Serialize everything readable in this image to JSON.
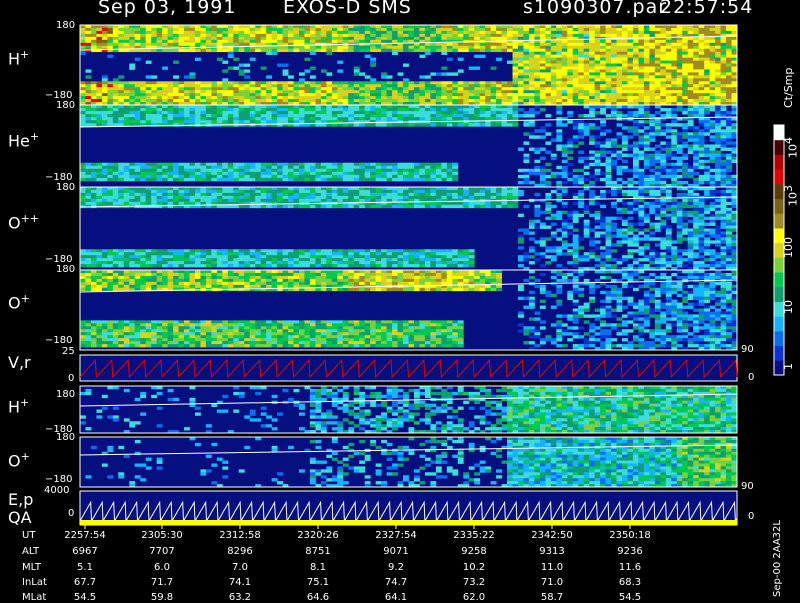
{
  "header": {
    "date": "Sep 03, 1991",
    "instrument": "EXOS-D SMS",
    "file": "s1090307.par",
    "time": "22:57:54"
  },
  "colorbar": {
    "unit": "Ct/Smp",
    "ticks": [
      "1",
      "10",
      "100",
      "10",
      "10"
    ],
    "tick_exps": [
      "",
      "",
      "",
      "3",
      "4"
    ],
    "colors": [
      "#050f80",
      "#0a32d2",
      "#0a6ef0",
      "#14b4ff",
      "#3cdcdc",
      "#0f9f6f",
      "#00c850",
      "#78d23c",
      "#d7d21e",
      "#ffff00",
      "#a08c1e",
      "#786414",
      "#5a3c0a",
      "#e60000",
      "#b40000",
      "#460000",
      "#ffffff"
    ]
  },
  "panels": [
    {
      "id": "h",
      "name": "H",
      "sup": "+",
      "top": "180",
      "bot": "−180"
    },
    {
      "id": "he",
      "name": "He",
      "sup": "+",
      "top": "180",
      "bot": "−180"
    },
    {
      "id": "o2",
      "name": "O",
      "sup": "++",
      "top": "180",
      "bot": "−180"
    },
    {
      "id": "o",
      "name": "O",
      "sup": "+",
      "top": "180",
      "bot": "−180"
    },
    {
      "id": "vr",
      "name": "V,r",
      "sup": "",
      "top": "25",
      "bot": "0",
      "right_top": "90",
      "right_bot": "0"
    },
    {
      "id": "h2",
      "name": "H",
      "sup": "+",
      "top": "180",
      "bot": "−180"
    },
    {
      "id": "o3",
      "name": "O",
      "sup": "+",
      "top": "180",
      "bot": "−180",
      "right_bot": "90"
    },
    {
      "id": "ep",
      "name": "E,p",
      "name2": "QA",
      "sup": "",
      "top": "4000",
      "bot": "0",
      "right_bot": "0"
    }
  ],
  "table": {
    "rows": [
      {
        "label": "UT",
        "values": [
          "2257:54",
          "2305:30",
          "2312:58",
          "2320:26",
          "2327:54",
          "2335:22",
          "2342:50",
          "2350:18"
        ]
      },
      {
        "label": "ALT",
        "values": [
          "6967",
          "7707",
          "8296",
          "8751",
          "9071",
          "9258",
          "9313",
          "9236"
        ]
      },
      {
        "label": "MLT",
        "values": [
          "5.1",
          "6.0",
          "7.0",
          "8.1",
          "9.2",
          "10.2",
          "11.0",
          "11.6"
        ]
      },
      {
        "label": "InLat",
        "values": [
          "67.7",
          "71.7",
          "74.1",
          "75.1",
          "74.7",
          "73.2",
          "71.0",
          "68.3"
        ]
      },
      {
        "label": "MLat",
        "values": [
          "54.5",
          "59.8",
          "63.2",
          "64.6",
          "64.1",
          "62.0",
          "58.7",
          "54.5"
        ]
      }
    ]
  },
  "stamp": "Sep-00  2AA32L",
  "chart_data": {
    "type": "heatmap",
    "title": "Sep 03, 1991   EXOS-D SMS   s1090307.par  22:57:54",
    "x_ticks": [
      "2257:54",
      "2305:30",
      "2312:58",
      "2320:26",
      "2327:54",
      "2335:22",
      "2342:50",
      "2350:18"
    ],
    "colorbar_unit": "Ct/Smp",
    "colorbar_range": [
      1,
      10000
    ],
    "colorbar_scale": "log",
    "series": [
      {
        "name": "H+",
        "ylim": [
          -180,
          180
        ]
      },
      {
        "name": "He+",
        "ylim": [
          -180,
          180
        ]
      },
      {
        "name": "O++",
        "ylim": [
          -180,
          180
        ]
      },
      {
        "name": "O+",
        "ylim": [
          -180,
          180
        ]
      },
      {
        "name": "V,r",
        "ylim": [
          0,
          25
        ]
      },
      {
        "name": "H+",
        "ylim": [
          -180,
          180
        ]
      },
      {
        "name": "O+",
        "ylim": [
          -180,
          180
        ]
      },
      {
        "name": "E,p",
        "ylim": [
          0,
          4000
        ]
      }
    ]
  }
}
